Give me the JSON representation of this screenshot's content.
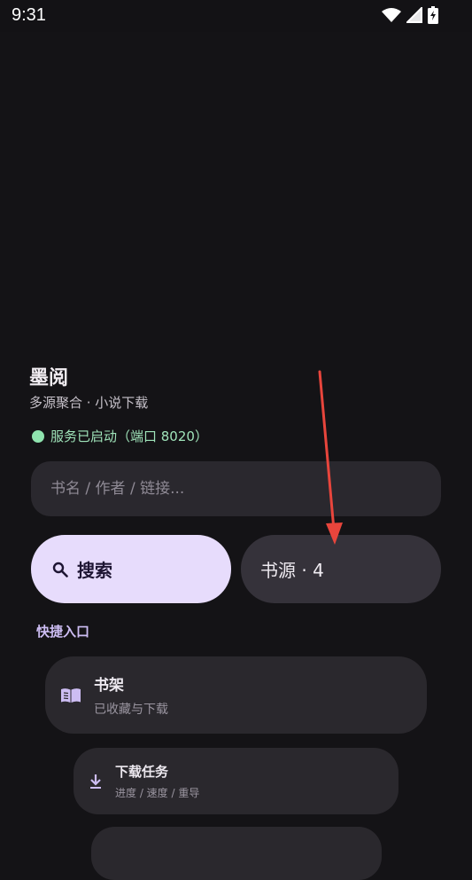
{
  "status_bar": {
    "time": "9:31",
    "icons": [
      "wifi-icon",
      "signal-icon",
      "battery-icon"
    ]
  },
  "app": {
    "title": "墨阅",
    "subtitle": "多源聚合 · 小说下载"
  },
  "service_status": {
    "text": "服务已启动（端口 8020）",
    "dot_color": "#8fe3ae"
  },
  "search": {
    "placeholder": "书名 / 作者 / 链接...",
    "value": "",
    "button_label": "搜索",
    "button_icon": "search-icon"
  },
  "sources": {
    "label": "书源 · 4"
  },
  "quick_entry": {
    "label": "快捷入口",
    "items": [
      {
        "title": "书架",
        "subtitle": "已收藏与下载",
        "icon": "book-icon"
      },
      {
        "title": "下载任务",
        "subtitle": "进度 / 速度 / 重导",
        "icon": "download-icon"
      }
    ]
  },
  "colors": {
    "background": "#141316",
    "accent": "#e7dcfc",
    "status_green": "#8fe3ae",
    "annotation_arrow": "#e8453c"
  }
}
